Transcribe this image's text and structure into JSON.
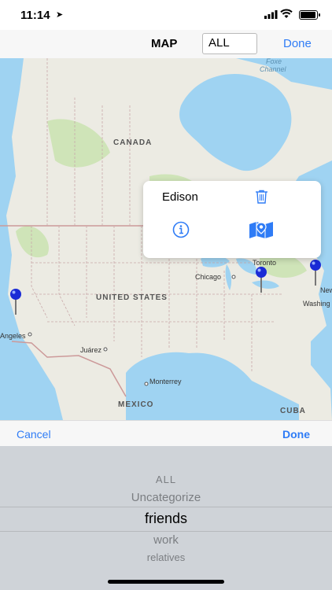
{
  "status_bar": {
    "time": "11:14"
  },
  "nav": {
    "title": "MAP",
    "filter_value": "ALL",
    "done_label": "Done"
  },
  "map_labels": {
    "canada": "CANADA",
    "united_states": "UNITED STATES",
    "mexico": "MEXICO",
    "cuba": "CUBA",
    "chicago": "Chicago",
    "toronto": "Toronto",
    "new_york": "New",
    "washington": "Washing",
    "los_angeles": "Angeles",
    "juarez": "Juárez",
    "monterrey": "Monterrey",
    "foxe_channel_1": "Foxe",
    "foxe_channel_2": "Channel"
  },
  "callout": {
    "name": "Edison"
  },
  "picker_toolbar": {
    "cancel_label": "Cancel",
    "done_label": "Done"
  },
  "picker": {
    "options": [
      "ALL",
      "Uncategorize",
      "friends",
      "work",
      "relatives"
    ],
    "selected": "friends"
  },
  "colors": {
    "accent": "#2f7cf6",
    "water": "#9fd3f2",
    "land": "#ecebe3",
    "forest": "#cfe4b8",
    "pin": "#1a2bd6"
  }
}
